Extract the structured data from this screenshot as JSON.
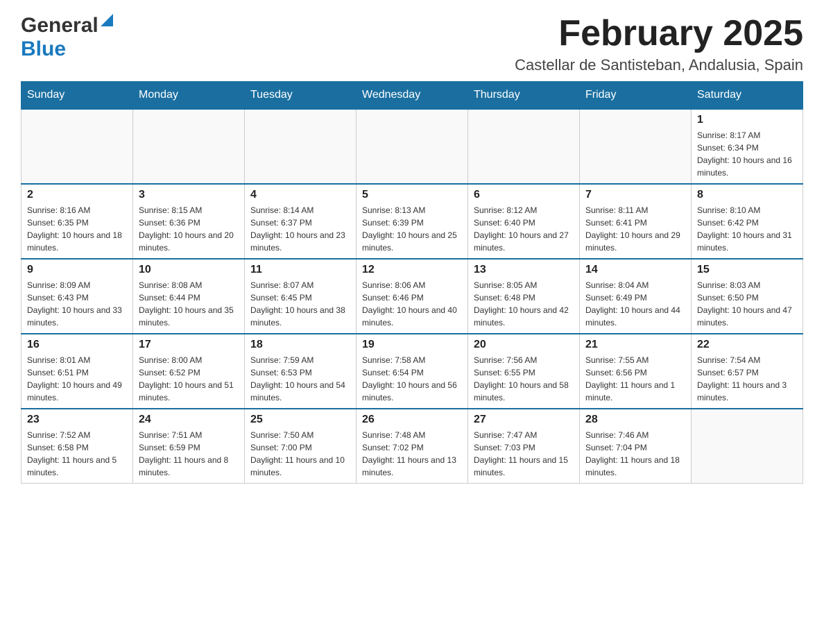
{
  "header": {
    "logo_general": "General",
    "logo_blue": "Blue",
    "month_title": "February 2025",
    "location": "Castellar de Santisteban, Andalusia, Spain"
  },
  "days_of_week": [
    "Sunday",
    "Monday",
    "Tuesday",
    "Wednesday",
    "Thursday",
    "Friday",
    "Saturday"
  ],
  "weeks": [
    {
      "days": [
        {
          "number": "",
          "info": ""
        },
        {
          "number": "",
          "info": ""
        },
        {
          "number": "",
          "info": ""
        },
        {
          "number": "",
          "info": ""
        },
        {
          "number": "",
          "info": ""
        },
        {
          "number": "",
          "info": ""
        },
        {
          "number": "1",
          "info": "Sunrise: 8:17 AM\nSunset: 6:34 PM\nDaylight: 10 hours and 16 minutes."
        }
      ]
    },
    {
      "days": [
        {
          "number": "2",
          "info": "Sunrise: 8:16 AM\nSunset: 6:35 PM\nDaylight: 10 hours and 18 minutes."
        },
        {
          "number": "3",
          "info": "Sunrise: 8:15 AM\nSunset: 6:36 PM\nDaylight: 10 hours and 20 minutes."
        },
        {
          "number": "4",
          "info": "Sunrise: 8:14 AM\nSunset: 6:37 PM\nDaylight: 10 hours and 23 minutes."
        },
        {
          "number": "5",
          "info": "Sunrise: 8:13 AM\nSunset: 6:39 PM\nDaylight: 10 hours and 25 minutes."
        },
        {
          "number": "6",
          "info": "Sunrise: 8:12 AM\nSunset: 6:40 PM\nDaylight: 10 hours and 27 minutes."
        },
        {
          "number": "7",
          "info": "Sunrise: 8:11 AM\nSunset: 6:41 PM\nDaylight: 10 hours and 29 minutes."
        },
        {
          "number": "8",
          "info": "Sunrise: 8:10 AM\nSunset: 6:42 PM\nDaylight: 10 hours and 31 minutes."
        }
      ]
    },
    {
      "days": [
        {
          "number": "9",
          "info": "Sunrise: 8:09 AM\nSunset: 6:43 PM\nDaylight: 10 hours and 33 minutes."
        },
        {
          "number": "10",
          "info": "Sunrise: 8:08 AM\nSunset: 6:44 PM\nDaylight: 10 hours and 35 minutes."
        },
        {
          "number": "11",
          "info": "Sunrise: 8:07 AM\nSunset: 6:45 PM\nDaylight: 10 hours and 38 minutes."
        },
        {
          "number": "12",
          "info": "Sunrise: 8:06 AM\nSunset: 6:46 PM\nDaylight: 10 hours and 40 minutes."
        },
        {
          "number": "13",
          "info": "Sunrise: 8:05 AM\nSunset: 6:48 PM\nDaylight: 10 hours and 42 minutes."
        },
        {
          "number": "14",
          "info": "Sunrise: 8:04 AM\nSunset: 6:49 PM\nDaylight: 10 hours and 44 minutes."
        },
        {
          "number": "15",
          "info": "Sunrise: 8:03 AM\nSunset: 6:50 PM\nDaylight: 10 hours and 47 minutes."
        }
      ]
    },
    {
      "days": [
        {
          "number": "16",
          "info": "Sunrise: 8:01 AM\nSunset: 6:51 PM\nDaylight: 10 hours and 49 minutes."
        },
        {
          "number": "17",
          "info": "Sunrise: 8:00 AM\nSunset: 6:52 PM\nDaylight: 10 hours and 51 minutes."
        },
        {
          "number": "18",
          "info": "Sunrise: 7:59 AM\nSunset: 6:53 PM\nDaylight: 10 hours and 54 minutes."
        },
        {
          "number": "19",
          "info": "Sunrise: 7:58 AM\nSunset: 6:54 PM\nDaylight: 10 hours and 56 minutes."
        },
        {
          "number": "20",
          "info": "Sunrise: 7:56 AM\nSunset: 6:55 PM\nDaylight: 10 hours and 58 minutes."
        },
        {
          "number": "21",
          "info": "Sunrise: 7:55 AM\nSunset: 6:56 PM\nDaylight: 11 hours and 1 minute."
        },
        {
          "number": "22",
          "info": "Sunrise: 7:54 AM\nSunset: 6:57 PM\nDaylight: 11 hours and 3 minutes."
        }
      ]
    },
    {
      "days": [
        {
          "number": "23",
          "info": "Sunrise: 7:52 AM\nSunset: 6:58 PM\nDaylight: 11 hours and 5 minutes."
        },
        {
          "number": "24",
          "info": "Sunrise: 7:51 AM\nSunset: 6:59 PM\nDaylight: 11 hours and 8 minutes."
        },
        {
          "number": "25",
          "info": "Sunrise: 7:50 AM\nSunset: 7:00 PM\nDaylight: 11 hours and 10 minutes."
        },
        {
          "number": "26",
          "info": "Sunrise: 7:48 AM\nSunset: 7:02 PM\nDaylight: 11 hours and 13 minutes."
        },
        {
          "number": "27",
          "info": "Sunrise: 7:47 AM\nSunset: 7:03 PM\nDaylight: 11 hours and 15 minutes."
        },
        {
          "number": "28",
          "info": "Sunrise: 7:46 AM\nSunset: 7:04 PM\nDaylight: 11 hours and 18 minutes."
        },
        {
          "number": "",
          "info": ""
        }
      ]
    }
  ]
}
